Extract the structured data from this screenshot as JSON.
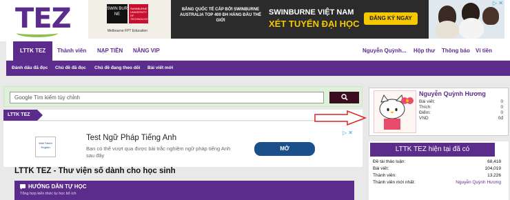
{
  "logo": {
    "text": "TEZ"
  },
  "banner": {
    "brand_box": "SWIN BUR NE",
    "brand_sub": "SWINBURNE UNIVERSITY OF TECHNOLOGY",
    "brand_partner": "Melbourne FPT Education",
    "headline": "BẰNG QUỐC TẾ CẤP BỞI SWINBURNE AUSTRALIA TOP 400 ĐH HÀNG ĐẦU THẾ GIỚI",
    "title": "SWINBURNE VIỆT NAM",
    "subtitle": "XÉT TUYỂN ĐẠI HỌC",
    "cta": "ĐĂNG KÝ NGAY",
    "controls": "▷ ✕"
  },
  "nav": {
    "items": [
      {
        "label": "LTTK TEZ"
      },
      {
        "label": "Thành viên"
      },
      {
        "label": "NẠP TIỀN"
      },
      {
        "label": "NÂNG VIP"
      }
    ],
    "right": [
      {
        "label": "Nguyễn Quỳnh..."
      },
      {
        "label": "Hộp thư"
      },
      {
        "label": "Thông báo"
      },
      {
        "label": "Ví tiền"
      }
    ]
  },
  "subnav": {
    "items": [
      {
        "label": "Đánh dấu đã đọc"
      },
      {
        "label": "Chủ đề đã đọc"
      },
      {
        "label": "Chủ đề đang theo dõi"
      },
      {
        "label": "Bài viết mới"
      }
    ]
  },
  "search": {
    "placeholder": "Google Tìm kiếm tùy chỉnh",
    "button_icon": "search-icon"
  },
  "section_tab": {
    "label": "LTTK TEZ"
  },
  "ad": {
    "logo": "Wall Street English",
    "title": "Test Ngữ Pháp Tiếng Anh",
    "desc": "Bạn có thể vượt qua được bài trắc nghiệm ngữ pháp tiếng Anh sau đây",
    "button": "MỞ",
    "controls": "▷ ✕"
  },
  "page_heading": "LTTK TEZ - Thư viện số dành cho học sinh",
  "guide": {
    "title": "HƯỚNG DẪN TỰ HỌC",
    "subtitle": "Tổng hợp kiến thức tự học bổ ích"
  },
  "user_panel": {
    "name": "Nguyễn Quỳnh Hương",
    "rows": [
      {
        "label": "Bài viết:",
        "value": "0"
      },
      {
        "label": "Thích:",
        "value": "0"
      },
      {
        "label": "Điểm:",
        "value": "0"
      },
      {
        "label": "VND",
        "value": "0đ"
      }
    ]
  },
  "stats": {
    "title": "LTTK TEZ hiện tại đã có",
    "rows": [
      {
        "label": "Đề tài thảo luận:",
        "value": "68,418"
      },
      {
        "label": "Bài viết:",
        "value": "104,019"
      },
      {
        "label": "Thành viên:",
        "value": "13,226"
      },
      {
        "label": "Thành viên mới nhất:",
        "value": "Nguyễn Quỳnh Hương"
      }
    ]
  },
  "colors": {
    "brand_purple": "#5b2c8b",
    "search_bg": "#dff0d8",
    "search_button": "#3a0e1e",
    "arrow_red": "#e02020",
    "banner_yellow": "#f6c800"
  }
}
